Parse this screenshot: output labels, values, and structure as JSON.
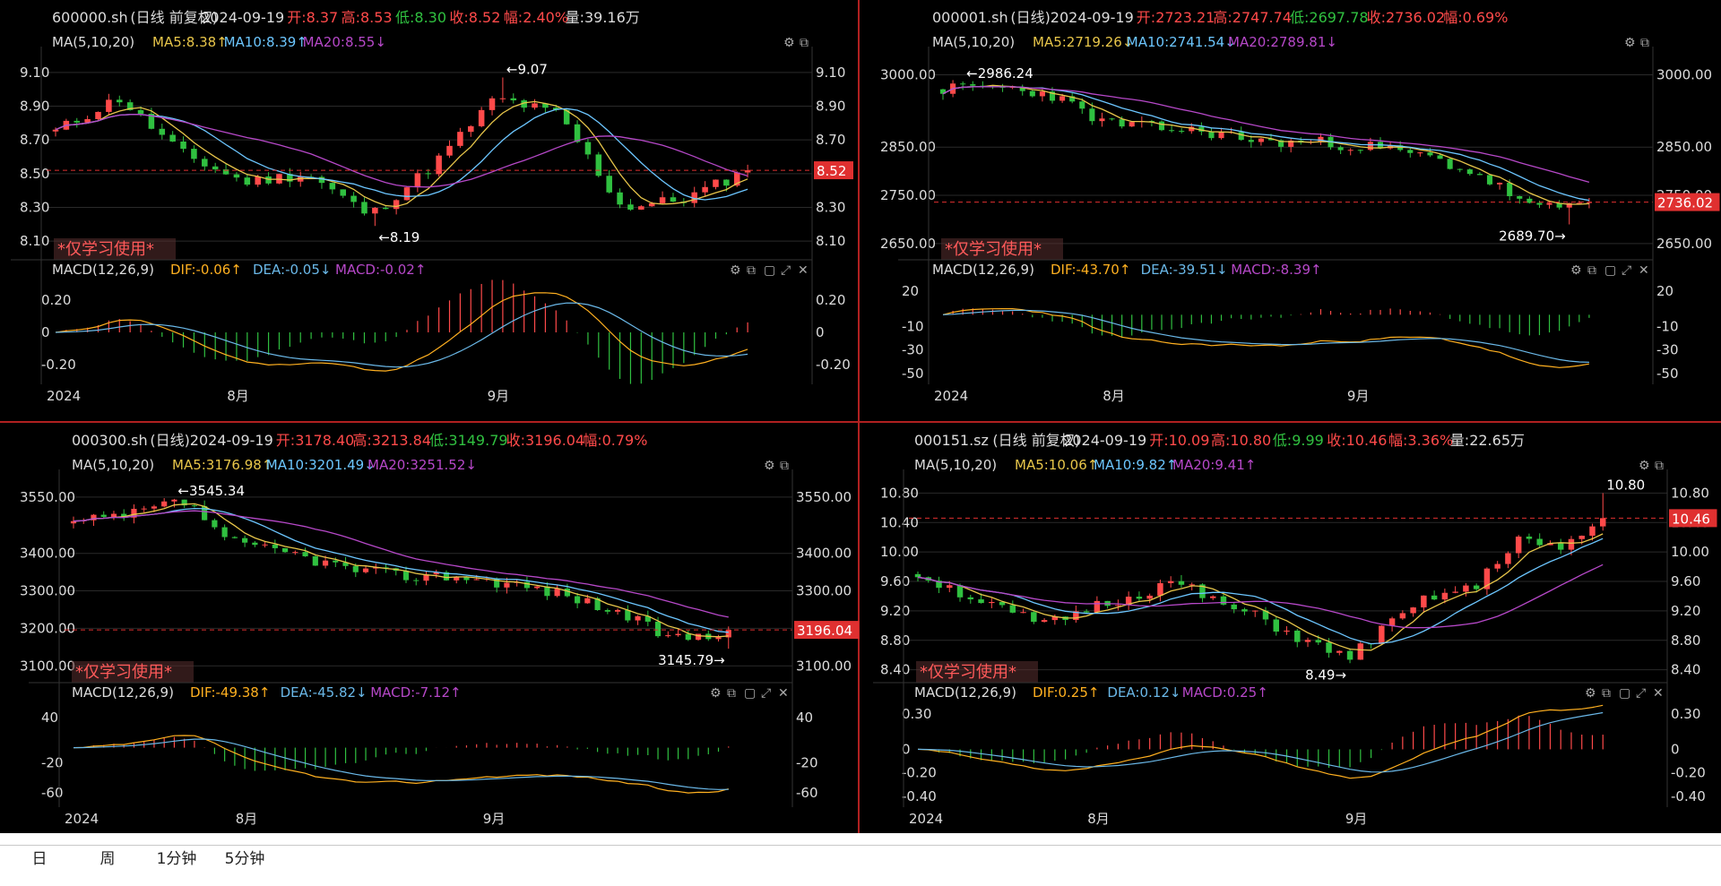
{
  "colors": {
    "up": "#ff4a4a",
    "down": "#30c040",
    "ma5": "#e8c64a",
    "ma10": "#6cc6ff",
    "ma20": "#b648c8",
    "dif": "#ffb020",
    "dea": "#6ab8e8",
    "grid": "#2a2a2a",
    "last": "#e03030",
    "title": "#dcdcdc",
    "watermark": "#ff5a5a"
  },
  "icons": [
    "settings-icon",
    "copy-icon",
    "window-icon",
    "maximize-icon",
    "close-icon"
  ],
  "tabs": [
    {
      "label": "日"
    },
    {
      "label": "周"
    },
    {
      "label": "1分钟"
    },
    {
      "label": "5分钟"
    }
  ],
  "panels": [
    {
      "title": {
        "code": "600000.sh",
        "mode": "(日线 前复权)",
        "date": "2024-09-19",
        "open": "开:8.37",
        "high": "高:8.53",
        "low": "低:8.30",
        "close": "收:8.52",
        "change": "幅:2.40%",
        "volume": "量:39.16万"
      },
      "ma": {
        "label": "MA(5,10,20)",
        "ma5": "MA5:8.38↑",
        "ma10": "MA10:8.39↑",
        "ma20": "MA20:8.55↓"
      },
      "macd": {
        "label": "MACD(12,26,9)",
        "dif": "DIF:-0.06↑",
        "dea": "DEA:-0.05↓",
        "macd": "MACD:-0.02↑"
      },
      "watermark": "*仅学习使用*",
      "price_ticks": [
        "9.10",
        "8.90",
        "8.70",
        "8.50",
        "8.30",
        "8.10"
      ],
      "price_tick_values": [
        9.1,
        8.9,
        8.7,
        8.5,
        8.3,
        8.1
      ],
      "macd_ticks": [
        "0.20",
        "0",
        "-0.20"
      ],
      "macd_tick_values": [
        0.2,
        0,
        -0.2
      ],
      "x_labels": [
        "2024",
        "8月",
        "9月"
      ],
      "last_price": "8.52",
      "high_annotation": "←9.07",
      "low_annotation": "←8.19",
      "chart_data": {
        "type": "candlestick",
        "start": 8.75,
        "end": 8.52,
        "high": 9.07,
        "low": 8.19,
        "ylim": [
          8.0,
          9.2
        ],
        "macd_ylim": [
          -0.33,
          0.33
        ],
        "seed": 11,
        "trend": [
          8.75,
          8.95,
          8.62,
          8.45,
          8.5,
          8.25,
          8.55,
          8.95,
          8.85,
          8.3,
          8.35,
          8.52
        ],
        "count": 66
      }
    },
    {
      "title": {
        "code": "000001.sh",
        "mode": "(日线)",
        "date": "2024-09-19",
        "open": "开:2723.21",
        "high": "高:2747.74",
        "low": "低:2697.78",
        "close": "收:2736.02",
        "change": "幅:0.69%",
        "volume": ""
      },
      "ma": {
        "label": "MA(5,10,20)",
        "ma5": "MA5:2719.26↓",
        "ma10": "MA10:2741.54↓",
        "ma20": "MA20:2789.81↓"
      },
      "macd": {
        "label": "MACD(12,26,9)",
        "dif": "DIF:-43.70↑",
        "dea": "DEA:-39.51↓",
        "macd": "MACD:-8.39↑"
      },
      "watermark": "*仅学习使用*",
      "price_ticks": [
        "3000.00",
        "2850.00",
        "2750.00",
        "2650.00"
      ],
      "price_tick_values": [
        3000,
        2850,
        2750,
        2650
      ],
      "macd_ticks": [
        "20",
        "-10",
        "-30",
        "-50"
      ],
      "macd_tick_values": [
        20,
        -10,
        -30,
        -50
      ],
      "x_labels": [
        "2024",
        "8月",
        "9月"
      ],
      "last_price": "2736.02",
      "high_annotation": "←2986.24",
      "low_annotation": "2689.70→",
      "chart_data": {
        "type": "candlestick",
        "start": 2970,
        "end": 2736,
        "high": 2986.24,
        "low": 2689.7,
        "ylim": [
          2620,
          3040
        ],
        "macd_ylim": [
          -60,
          30
        ],
        "seed": 23,
        "trend": [
          2970,
          2975,
          2960,
          2900,
          2890,
          2880,
          2860,
          2860,
          2850,
          2830,
          2790,
          2720,
          2736
        ],
        "count": 66
      }
    },
    {
      "title": {
        "code": "000300.sh",
        "mode": "(日线)",
        "date": "2024-09-19",
        "open": "开:3178.40",
        "high": "高:3213.84",
        "low": "低:3149.79",
        "close": "收:3196.04",
        "change": "幅:0.79%",
        "volume": ""
      },
      "ma": {
        "label": "MA(5,10,20)",
        "ma5": "MA5:3176.98↑",
        "ma10": "MA10:3201.49↓",
        "ma20": "MA20:3251.52↓"
      },
      "macd": {
        "label": "MACD(12,26,9)",
        "dif": "DIF:-49.38↑",
        "dea": "DEA:-45.82↓",
        "macd": "MACD:-7.12↑"
      },
      "watermark": "*仅学习使用*",
      "price_ticks": [
        "3550.00",
        "3400.00",
        "3300.00",
        "3200.00",
        "3100.00"
      ],
      "price_tick_values": [
        3550,
        3400,
        3300,
        3200,
        3100
      ],
      "macd_ticks": [
        "40",
        "-20",
        "-60"
      ],
      "macd_tick_values": [
        40,
        -20,
        -60
      ],
      "x_labels": [
        "2024",
        "8月",
        "9月"
      ],
      "last_price": "3196.04",
      "high_annotation": "←3545.34",
      "low_annotation": "3145.79→",
      "chart_data": {
        "type": "candlestick",
        "start": 3480,
        "end": 3196,
        "high": 3545.34,
        "low": 3145.79,
        "ylim": [
          3060,
          3600
        ],
        "macd_ylim": [
          -80,
          60
        ],
        "seed": 37,
        "trend": [
          3480,
          3500,
          3540,
          3420,
          3400,
          3360,
          3340,
          3340,
          3320,
          3290,
          3240,
          3170,
          3196
        ],
        "count": 66
      }
    },
    {
      "title": {
        "code": "000151.sz",
        "mode": "(日线 前复权)",
        "date": "2024-09-19",
        "open": "开:10.09",
        "high": "高:10.80",
        "low": "低:9.99",
        "close": "收:10.46",
        "change": "幅:3.36%",
        "volume": "量:22.65万"
      },
      "ma": {
        "label": "MA(5,10,20)",
        "ma5": "MA5:10.06↑",
        "ma10": "MA10:9.82↑",
        "ma20": "MA20:9.41↑"
      },
      "macd": {
        "label": "MACD(12,26,9)",
        "dif": "DIF:0.25↑",
        "dea": "DEA:0.12↓",
        "macd": "MACD:0.25↑"
      },
      "watermark": "*仅学习使用*",
      "price_ticks": [
        "10.80",
        "10.40",
        "10.00",
        "9.60",
        "9.20",
        "8.80",
        "8.40"
      ],
      "price_tick_values": [
        10.8,
        10.4,
        10.0,
        9.6,
        9.2,
        8.8,
        8.4
      ],
      "macd_ticks": [
        "0.30",
        "0",
        "-0.20",
        "-0.40"
      ],
      "macd_tick_values": [
        0.3,
        0,
        -0.2,
        -0.4
      ],
      "x_labels": [
        "2024",
        "8月",
        "9月"
      ],
      "last_price": "10.46",
      "high_annotation": "10.80",
      "low_annotation": "8.49→",
      "chart_data": {
        "type": "candlestick",
        "start": 9.7,
        "end": 10.46,
        "high": 10.8,
        "low": 8.49,
        "ylim": [
          8.25,
          11.0
        ],
        "macd_ylim": [
          -0.5,
          0.4
        ],
        "seed": 51,
        "trend": [
          9.7,
          9.45,
          9.2,
          9.0,
          9.25,
          9.4,
          9.6,
          9.3,
          9.1,
          8.8,
          8.55,
          9.0,
          9.4,
          9.5,
          10.2,
          10.0,
          10.46
        ],
        "count": 66
      }
    }
  ]
}
